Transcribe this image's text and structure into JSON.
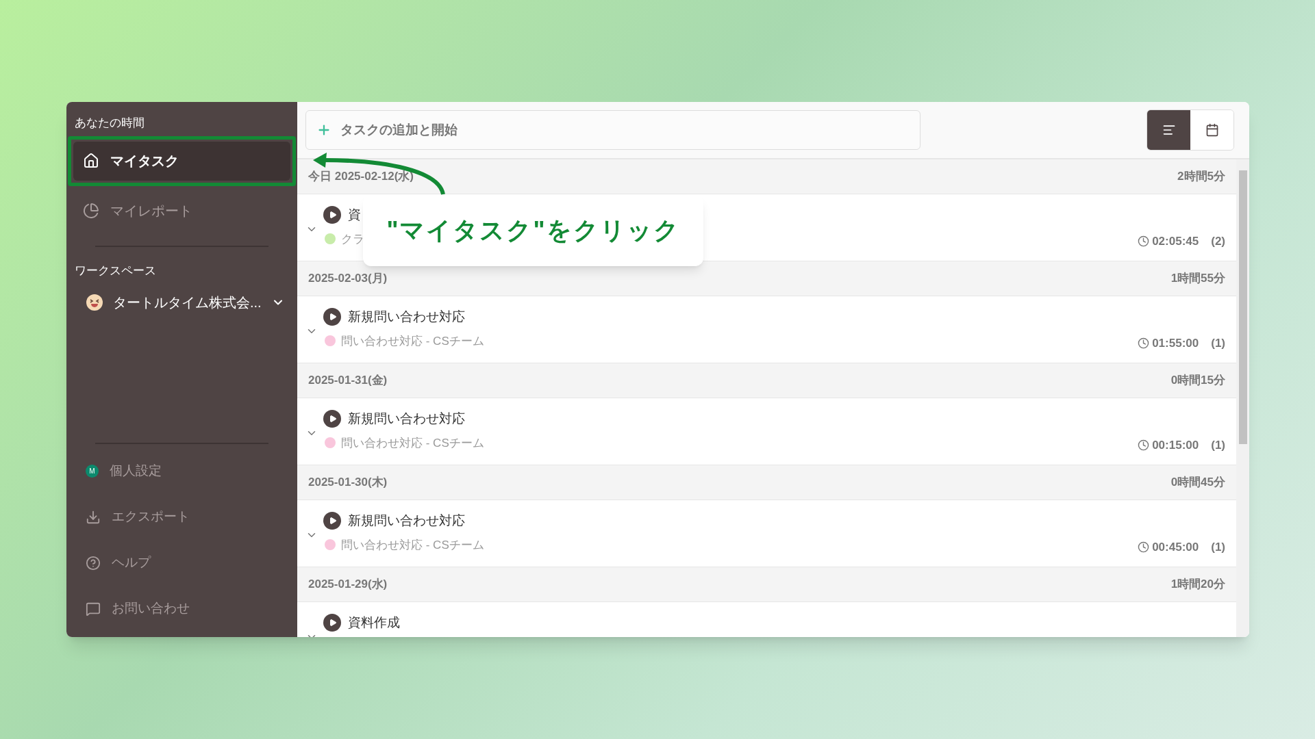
{
  "sidebar": {
    "section_label": "あなたの時間",
    "nav": [
      {
        "label": "マイタスク",
        "selected": true
      },
      {
        "label": "マイレポート",
        "selected": false
      }
    ],
    "workspace_label": "ワークスペース",
    "workspace": {
      "name": "タートルタイム株式会..."
    },
    "bottom_items": [
      {
        "label": "個人設定",
        "kind": "avatar",
        "avatar": "M"
      },
      {
        "label": "エクスポート",
        "kind": "icon"
      },
      {
        "label": "ヘルプ",
        "kind": "icon"
      },
      {
        "label": "お問い合わせ",
        "kind": "icon"
      }
    ]
  },
  "add_task": {
    "placeholder": "タスクの追加と開始"
  },
  "view_toggle": [
    {
      "selected": true
    },
    {
      "selected": false
    }
  ],
  "groups": [
    {
      "date": "今日 2025-02-12(水)",
      "total": "2時間5分",
      "tasks": [
        {
          "name": "資",
          "project": "クラ",
          "color": "#c8ecaa",
          "duration": "02:05:45",
          "count": "(2)"
        }
      ]
    },
    {
      "date": "2025-02-03(月)",
      "total": "1時間55分",
      "tasks": [
        {
          "name": "新規問い合わせ対応",
          "project": "問い合わせ対応 - CSチーム",
          "color": "#f9c6dc",
          "duration": "01:55:00",
          "count": "(1)"
        }
      ]
    },
    {
      "date": "2025-01-31(金)",
      "total": "0時間15分",
      "tasks": [
        {
          "name": "新規問い合わせ対応",
          "project": "問い合わせ対応 - CSチーム",
          "color": "#f9c6dc",
          "duration": "00:15:00",
          "count": "(1)"
        }
      ]
    },
    {
      "date": "2025-01-30(木)",
      "total": "0時間45分",
      "tasks": [
        {
          "name": "新規問い合わせ対応",
          "project": "問い合わせ対応 - CSチーム",
          "color": "#f9c6dc",
          "duration": "00:45:00",
          "count": "(1)"
        }
      ]
    },
    {
      "date": "2025-01-29(水)",
      "total": "1時間20分",
      "tasks": [
        {
          "name": "資料作成"
        }
      ]
    }
  ],
  "callout": {
    "text": "\"マイタスク\"をクリック"
  }
}
